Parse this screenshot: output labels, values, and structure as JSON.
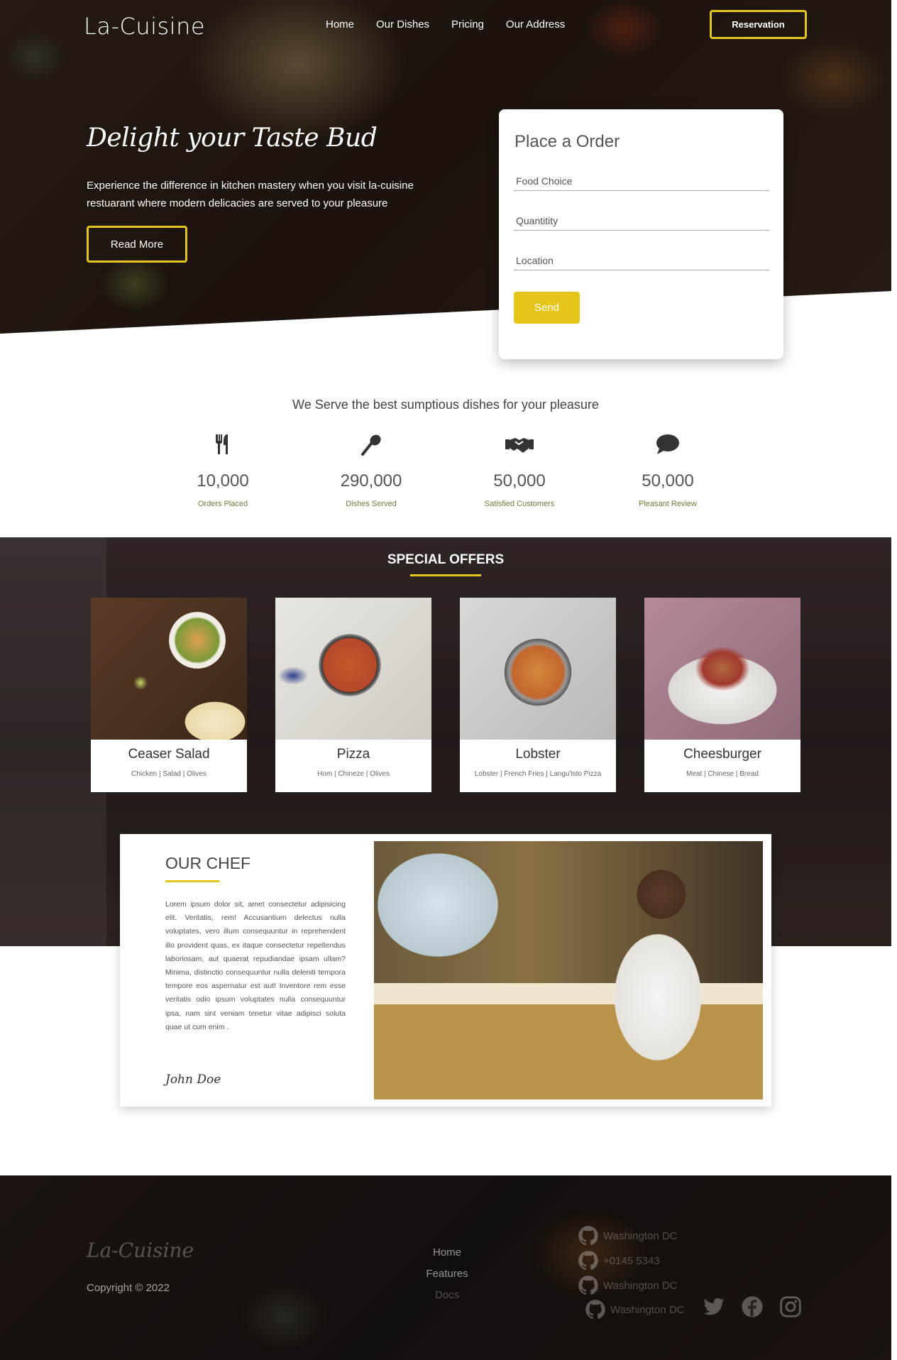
{
  "brand": "La-Cuisine",
  "nav": [
    "Home",
    "Our Dishes",
    "Pricing",
    "Our Address"
  ],
  "reservation_label": "Reservation",
  "hero": {
    "title": "Delight your Taste Bud",
    "text": "Experience the difference in kitchen mastery when you visit la-cuisine restuarant where modern delicacies are served to your pleasure",
    "button": "Read More"
  },
  "order": {
    "title": "Place a Order",
    "fields": [
      "Food Choice",
      "Quantitity",
      "Location"
    ],
    "send": "Send"
  },
  "stats": {
    "title": "We Serve the best sumptious dishes for your pleasure",
    "items": [
      {
        "icon": "utensils-icon",
        "value": "10,000",
        "label": "Orders Placed"
      },
      {
        "icon": "spoon-icon",
        "value": "290,000",
        "label": "Dishes Served"
      },
      {
        "icon": "handshake-icon",
        "value": "50,000",
        "label": "Satisfied Customers"
      },
      {
        "icon": "comment-icon",
        "value": "50,000",
        "label": "Pleasant Review"
      }
    ]
  },
  "offers": {
    "title": "SPECIAL OFFERS",
    "items": [
      {
        "name": "Ceaser Salad",
        "tags": "Chicken | Salad | Olives"
      },
      {
        "name": "Pizza",
        "tags": "Hom | Chineze | Olives"
      },
      {
        "name": "Lobster",
        "tags": "Lobster | French Fries | Langu'isto Pizza"
      },
      {
        "name": "Cheesburger",
        "tags": "Meat | Chinese | Bread"
      }
    ]
  },
  "chef": {
    "title": "OUR CHEF",
    "text": "Lorem ipsum dolor sit, amet consectetur adipisicing elit. Veritatis, rem! Accusantium delectus nulla voluptates, vero illum consequuntur in reprehenderit illo provident quas, ex itaque consectetur repellendus laboriosam, aut quaerat repudiandae ipsam ullam? Minima, distinctio consequuntur nulla deleniti tempora tempore eos aspernatur est aut! Inventore rem esse veritatis odio ipsum voluptates nulla consequuntur ipsa, nam sint veniam tenetur vitae adipisci soluta quae ut cum enim .",
    "signature": "John Doe"
  },
  "footer": {
    "brand": "La-Cuisine",
    "copyright": "Copyright © 2022",
    "links": [
      "Home",
      "Features",
      "Docs"
    ],
    "contacts": [
      "Washington DC",
      "+0145 5343",
      "Washington DC",
      "Washington DC"
    ]
  },
  "colors": {
    "accent": "#e5c51a",
    "label_green": "#6b7d3a"
  }
}
